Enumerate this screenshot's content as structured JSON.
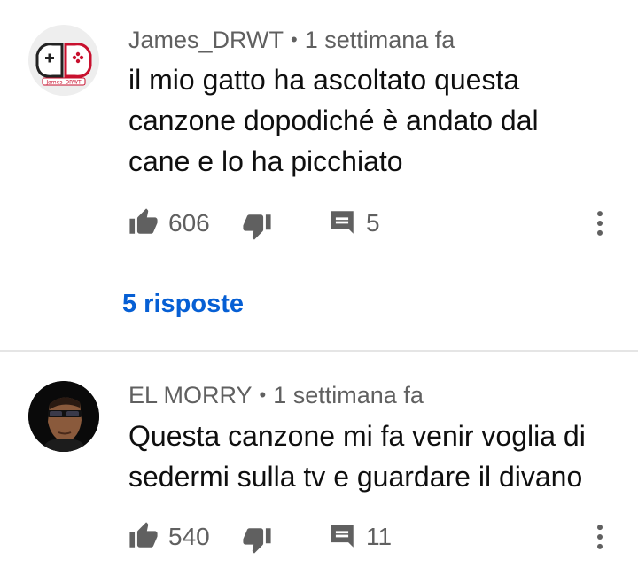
{
  "comments": [
    {
      "author": "James_DRWT",
      "time": "1 settimana fa",
      "avatar_label": "James_DRWT",
      "text_lines": [
        "il mio gatto ha ascoltato questa",
        "canzone dopodiché è andato dal",
        "cane e lo ha picchiato"
      ],
      "likes": "606",
      "replies_count": "5",
      "replies_link": "5 risposte"
    },
    {
      "author": "EL MORRY",
      "time": "1 settimana fa",
      "text_lines": [
        "Questa canzone mi fa venir voglia di",
        "sedermi sulla tv e guardare il divano"
      ],
      "likes": "540",
      "replies_count": "11"
    }
  ],
  "separator": "•",
  "icons": {
    "like": "thumb-up-icon",
    "dislike": "thumb-down-icon",
    "reply": "comment-icon",
    "more": "more-vert-icon"
  },
  "colors": {
    "link": "#065fd4",
    "meta": "#606060",
    "text": "#0f0f0f",
    "divider": "#e5e5e5"
  }
}
